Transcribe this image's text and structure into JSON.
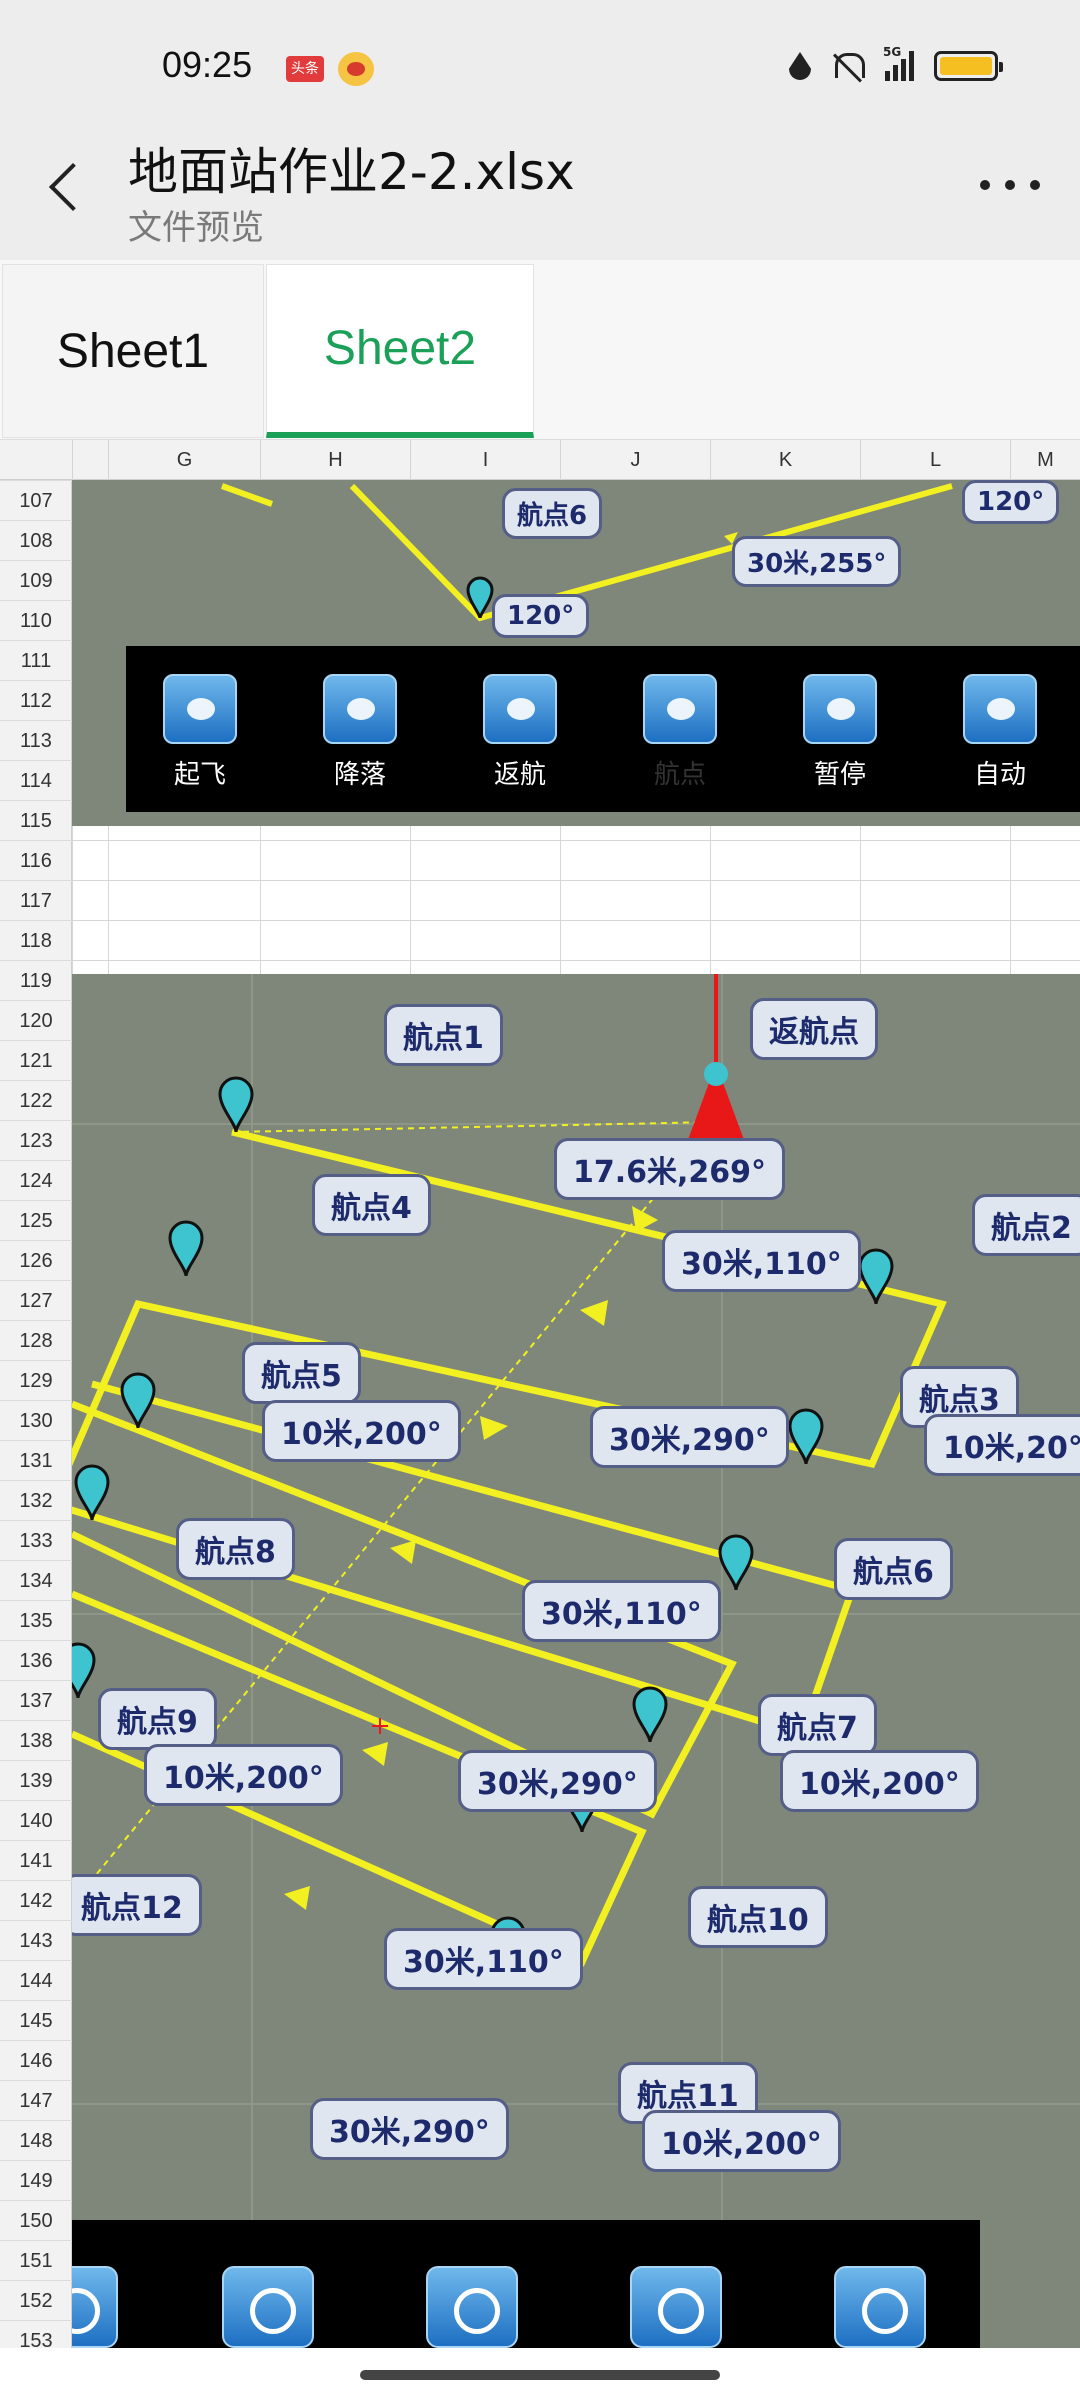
{
  "status_bar": {
    "time": "09:25",
    "badges": [
      "头条",
      "weibo-icon"
    ],
    "network": "5G",
    "icons": [
      "data-saver-icon",
      "mute-icon",
      "signal-icon",
      "battery-icon"
    ]
  },
  "header": {
    "title": "地面站作业2-2.xlsx",
    "subtitle": "文件预览",
    "back_icon": "chevron-left-icon",
    "more_icon": "more-horizontal-icon"
  },
  "sheet_tabs": [
    {
      "label": "Sheet1",
      "active": false
    },
    {
      "label": "Sheet2",
      "active": true
    }
  ],
  "accent_color": "#1aa057",
  "columns": [
    "G",
    "H",
    "I",
    "J",
    "K",
    "L",
    "M"
  ],
  "rows": [
    "107",
    "108",
    "109",
    "110",
    "111",
    "112",
    "113",
    "114",
    "115",
    "116",
    "117",
    "118",
    "119",
    "120",
    "121",
    "122",
    "123",
    "124",
    "125",
    "126",
    "127",
    "128",
    "129",
    "130",
    "131",
    "132",
    "133",
    "134",
    "135",
    "136",
    "137",
    "138",
    "139",
    "140",
    "141",
    "142",
    "143",
    "144",
    "145",
    "146",
    "147",
    "148",
    "149",
    "150",
    "151",
    "152",
    "153"
  ],
  "top_image": {
    "labels": [
      "航点6",
      "30米,255°",
      "120°",
      "120°"
    ],
    "toolbar": [
      {
        "label": "起飞",
        "icon": "takeoff-icon"
      },
      {
        "label": "降落",
        "icon": "landing-icon"
      },
      {
        "label": "返航",
        "icon": "return-home-icon"
      },
      {
        "label": "航点",
        "icon": "waypoint-icon"
      },
      {
        "label": "暂停",
        "icon": "pause-icon"
      },
      {
        "label": "自动",
        "icon": "auto-icon"
      }
    ]
  },
  "main_image": {
    "waypoints": [
      "航点1",
      "返航点",
      "航点4",
      "航点5",
      "航点3",
      "航点8",
      "航点6",
      "航点9",
      "航点7",
      "航点12",
      "航点10",
      "航点11",
      "航点2"
    ],
    "segments": [
      "17.6米,269°",
      "30米,110°",
      "10米,200°",
      "30米,290°",
      "10米,20°",
      "30米,110°",
      "30米,290°",
      "10米,200°",
      "10米,200°",
      "30米,110°",
      "10米,200°",
      "30米,290°"
    ],
    "bottom_toolbar_icons": [
      "landing-icon",
      "return-home-icon",
      "waypoint-icon",
      "pause-icon",
      "auto-icon"
    ]
  }
}
